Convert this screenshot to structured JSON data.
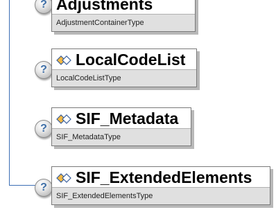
{
  "nodes": [
    {
      "name": "Adjustments",
      "type": "AdjustmentContainerType"
    },
    {
      "name": "LocalCodeList",
      "type": "LocalCodeListType"
    },
    {
      "name": "SIF_Metadata",
      "type": "SIF_MetadataType"
    },
    {
      "name": "SIF_ExtendedElements",
      "type": "SIF_ExtendedElementsType"
    }
  ],
  "help_glyph": "?",
  "colors": {
    "connector": "#3c6fb5",
    "icon_fill": "#f5b942",
    "icon_outline": "#3a5f9a",
    "type_band": "#e0e0e0"
  }
}
